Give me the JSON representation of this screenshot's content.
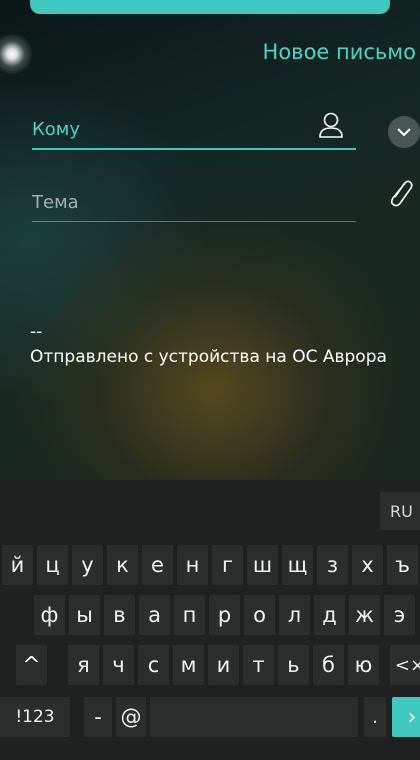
{
  "header": {
    "title": "Новое письмо"
  },
  "compose": {
    "to_label": "Кому",
    "subject_label": "Тема",
    "signature_separator": "--",
    "signature_text": "Отправлено с устройства на ОС Аврора"
  },
  "keyboard": {
    "language": "RU",
    "row1": [
      "й",
      "ц",
      "у",
      "к",
      "е",
      "н",
      "г",
      "ш",
      "щ",
      "з",
      "х",
      "ъ"
    ],
    "row2": [
      "ф",
      "ы",
      "в",
      "а",
      "п",
      "р",
      "о",
      "л",
      "д",
      "ж",
      "э"
    ],
    "row3": [
      "я",
      "ч",
      "с",
      "м",
      "и",
      "т",
      "ь",
      "б",
      "ю"
    ],
    "shift_symbol": "^",
    "backspace_symbol": "<×",
    "symbols_label": "!123",
    "dash_label": "-",
    "at_label": "@",
    "dot_label": ".",
    "enter_symbol": "›"
  },
  "colors": {
    "accent": "#3fc8bd",
    "keyboard_bg": "#1f2120"
  }
}
